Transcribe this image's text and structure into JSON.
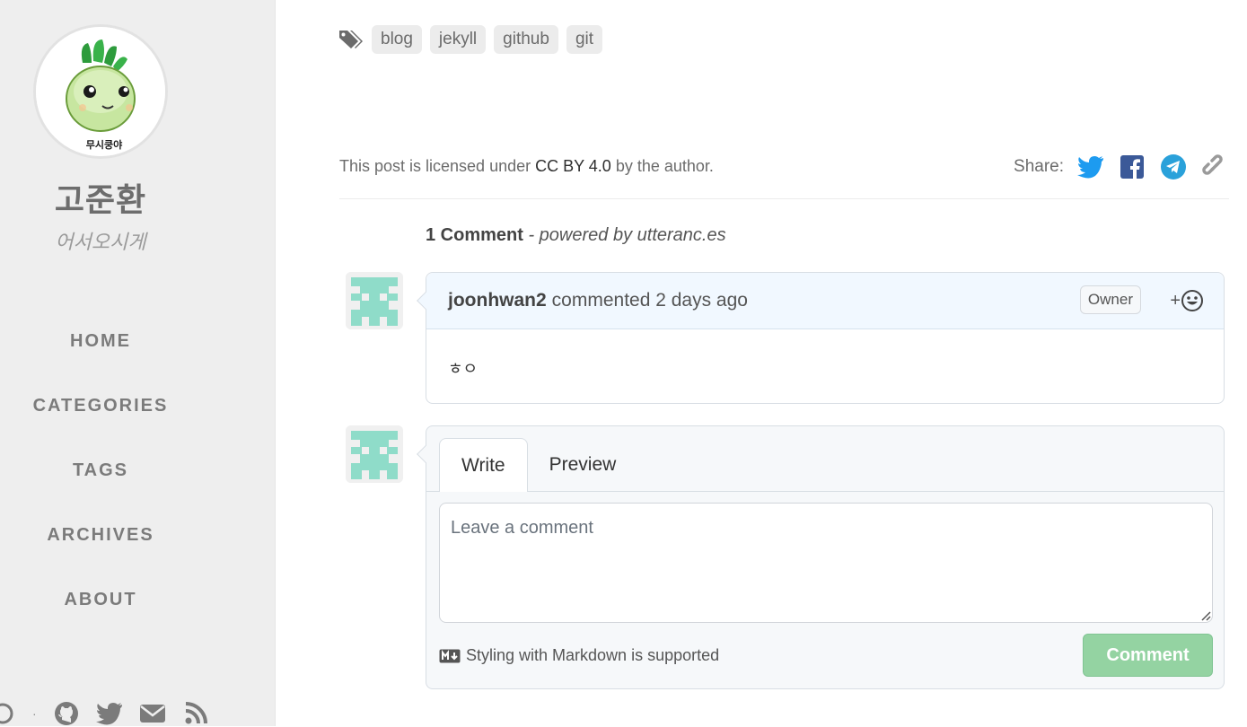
{
  "sidebar": {
    "title": "고준환",
    "subtitle": "어서오시게",
    "avatar_caption": "무시쿵야",
    "nav": [
      {
        "label": "HOME"
      },
      {
        "label": "CATEGORIES"
      },
      {
        "label": "TAGS"
      },
      {
        "label": "ARCHIVES"
      },
      {
        "label": "ABOUT"
      }
    ],
    "bottom_icons": [
      "theme-toggle-icon",
      "github-icon",
      "twitter-icon",
      "email-icon",
      "rss-icon"
    ],
    "separator": "·"
  },
  "post": {
    "tags_icon": "tags-icon",
    "tags": [
      "blog",
      "jekyll",
      "github",
      "git"
    ],
    "license": {
      "prefix": "This post is licensed under ",
      "link": "CC BY 4.0",
      "suffix": " by the author."
    },
    "share": {
      "label": "Share:",
      "icons": [
        "twitter-icon",
        "facebook-icon",
        "telegram-icon",
        "link-icon"
      ]
    }
  },
  "comments": {
    "count_label": "1 Comment",
    "powered_by": " - powered by utteranc.es",
    "items": [
      {
        "author": "joonhwan2",
        "meta": "commented 2 days ago",
        "badge": "Owner",
        "reaction_label": "+",
        "body": "ㅎㅇ"
      }
    ],
    "editor": {
      "tabs": [
        "Write",
        "Preview"
      ],
      "placeholder": "Leave a comment",
      "markdown_hint": "Styling with Markdown is supported",
      "submit_label": "Comment"
    }
  },
  "colors": {
    "sidebar_bg": "#eeeeee",
    "comment_head_bg": "#f1f8ff",
    "submit_bg": "#94d3a2",
    "twitter": "#1d9bf0",
    "facebook": "#3b5998",
    "telegram": "#2aa1da",
    "identicon": "#8fdcc9"
  }
}
